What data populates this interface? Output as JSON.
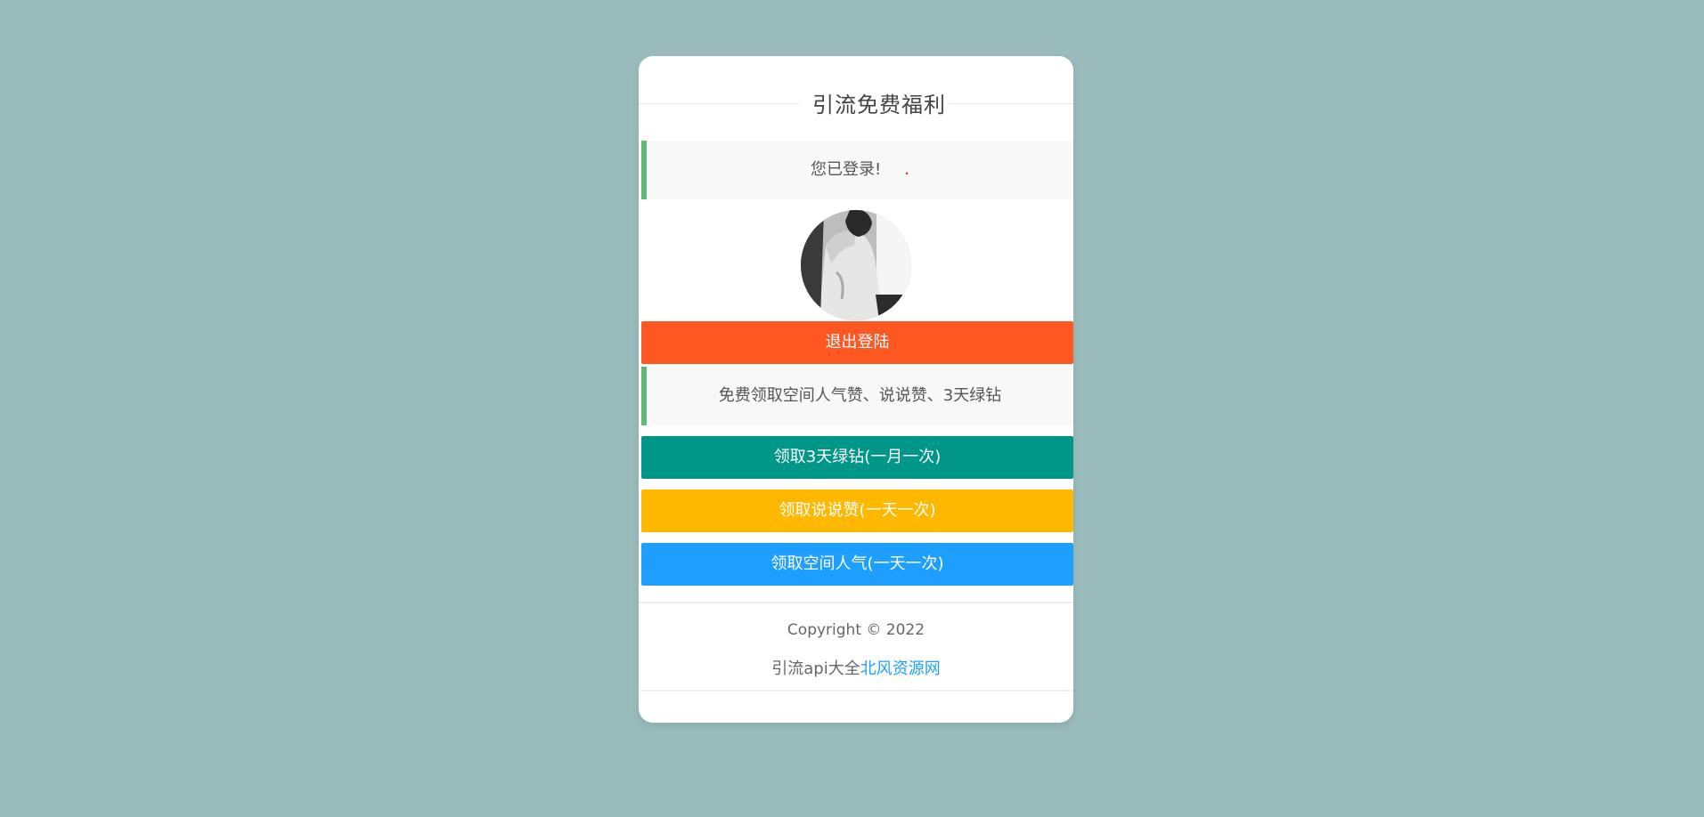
{
  "page": {
    "background_color": "#99bbbb"
  },
  "header": {
    "title": "引流免费福利"
  },
  "status": {
    "logged_in_text": "您已登录!",
    "dot": "."
  },
  "logout": {
    "label": "退出登陆"
  },
  "info": {
    "text": "免费领取空间人气赞、说说赞、3天绿钻"
  },
  "actions": {
    "green_diamond_label": "领取3天绿钻(一月一次)",
    "shuoshuo_like_label": "领取说说赞(一天一次)",
    "space_popularity_label": "领取空间人气(一天一次)"
  },
  "footer": {
    "copyright": "Copyright © 2022",
    "prefix": "引流api大全",
    "link_text": "北风资源网"
  },
  "colors": {
    "logout": "#ff5722",
    "green": "#009688",
    "yellow": "#ffb800",
    "blue": "#1e9fff",
    "accent_border": "#5fb878"
  },
  "icons": {
    "avatar": "user-avatar-photo"
  }
}
